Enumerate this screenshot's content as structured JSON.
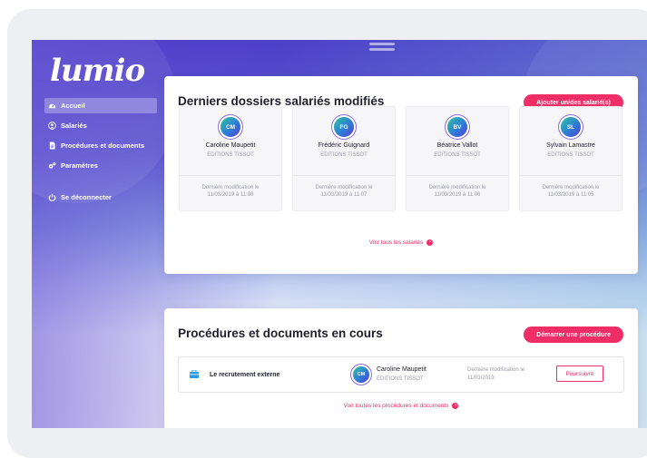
{
  "app": {
    "logo": "lumio"
  },
  "sidebar": {
    "items": [
      {
        "label": "Accueil",
        "icon": "dashboard-icon",
        "active": true
      },
      {
        "label": "Salariés",
        "icon": "user-icon"
      },
      {
        "label": "Procédures et documents",
        "icon": "document-icon"
      },
      {
        "label": "Paramètres",
        "icon": "gears-icon"
      }
    ],
    "logout": {
      "label": "Se déconnecter",
      "icon": "power-icon"
    }
  },
  "recent": {
    "title": "Derniers dossiers salariés modifiés",
    "add_button": "Ajouter un/des salarié(s)",
    "modified_label": "Dernière modification le",
    "employees": [
      {
        "initials": "CM",
        "name": "Caroline Maupetit",
        "company": "EDITIONS TISSOT",
        "modified": "11/03/2019 à 11:08"
      },
      {
        "initials": "FG",
        "name": "Frédéric Guignard",
        "company": "EDITIONS TISSOT",
        "modified": "11/03/2019 à 11:07"
      },
      {
        "initials": "BV",
        "name": "Béatrice Vallot",
        "company": "EDITIONS TISSOT",
        "modified": "11/03/2019 à 11:06"
      },
      {
        "initials": "SL",
        "name": "Sylvain Lamastre",
        "company": "EDITIONS TISSOT",
        "modified": "11/03/2019 à 11:05"
      }
    ],
    "see_all": "Voir tous les salariés"
  },
  "procedures": {
    "title": "Procédures et documents en cours",
    "start_button": "Démarrer une procédure",
    "items": [
      {
        "title": "Le recrutement externe",
        "initials": "CM",
        "employee": "Caroline Maupetit",
        "company": "EDITIONS TISSOT",
        "modified_label": "Dernière modification le",
        "modified_date": "11/03/2019",
        "action": "Poursuivre"
      }
    ],
    "see_all": "Voir toutes les procédures et documents"
  },
  "colors": {
    "accent": "#ef2d67",
    "sidebar_top": "#4c3fc8",
    "card_bg": "#ffffff"
  }
}
